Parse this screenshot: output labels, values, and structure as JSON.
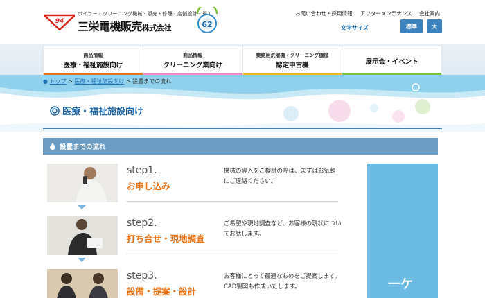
{
  "header": {
    "tagline": "ボイラー・クリーニング機械・販売・修理・店舗設計・施工",
    "company_main": "三栄電機販売",
    "company_suffix": "株式会社",
    "logo_text": "94",
    "anniversary_number": "62",
    "top_links": [
      "お問い合わせ・採用情報",
      "アフターメンテナンス",
      "会社案内"
    ],
    "font_size_label": "文字サイズ",
    "font_size_standard": "標準",
    "font_size_large": "大"
  },
  "nav": {
    "items": [
      {
        "sub": "商品情報",
        "label": "医療・福祉施設向け",
        "color": "#e8741a"
      },
      {
        "sub": "商品情報",
        "label": "クリーニング業向け",
        "color": "#ef8cc2"
      },
      {
        "sub": "業務用洗濯機・クリーニング機械",
        "label": "認定中古機",
        "color": "#f2b51d"
      },
      {
        "sub": "",
        "label": "展示会・イベント",
        "color": "#7fc03f"
      }
    ]
  },
  "breadcrumb": {
    "top": "トップ",
    "medical": "医療・福祉施設向け",
    "current": "設置までの流れ",
    "sep": ">"
  },
  "page": {
    "title": "医療・福祉施設向け",
    "section": "設置までの流れ",
    "sidebar_text": "一ケ"
  },
  "steps": [
    {
      "num": "step1.",
      "title": "お申し込み",
      "desc": "機械の導入をご検討の際は、まずはお気軽にご連絡ください。"
    },
    {
      "num": "step2.",
      "title": "打ち合せ・現地調査",
      "desc": "ご希望や現地調査など、お客様の現状についてお話します。"
    },
    {
      "num": "step3.",
      "title": "設備・提案・設計",
      "desc": "お客様にとって最適なものをご提案します。CAD製図も作成いたします。"
    }
  ],
  "colors": {
    "primary_blue": "#1f73b7",
    "section_bar": "#6a9cc4",
    "step_title": "#e8741a",
    "sidebar": "#6bbbe4"
  }
}
